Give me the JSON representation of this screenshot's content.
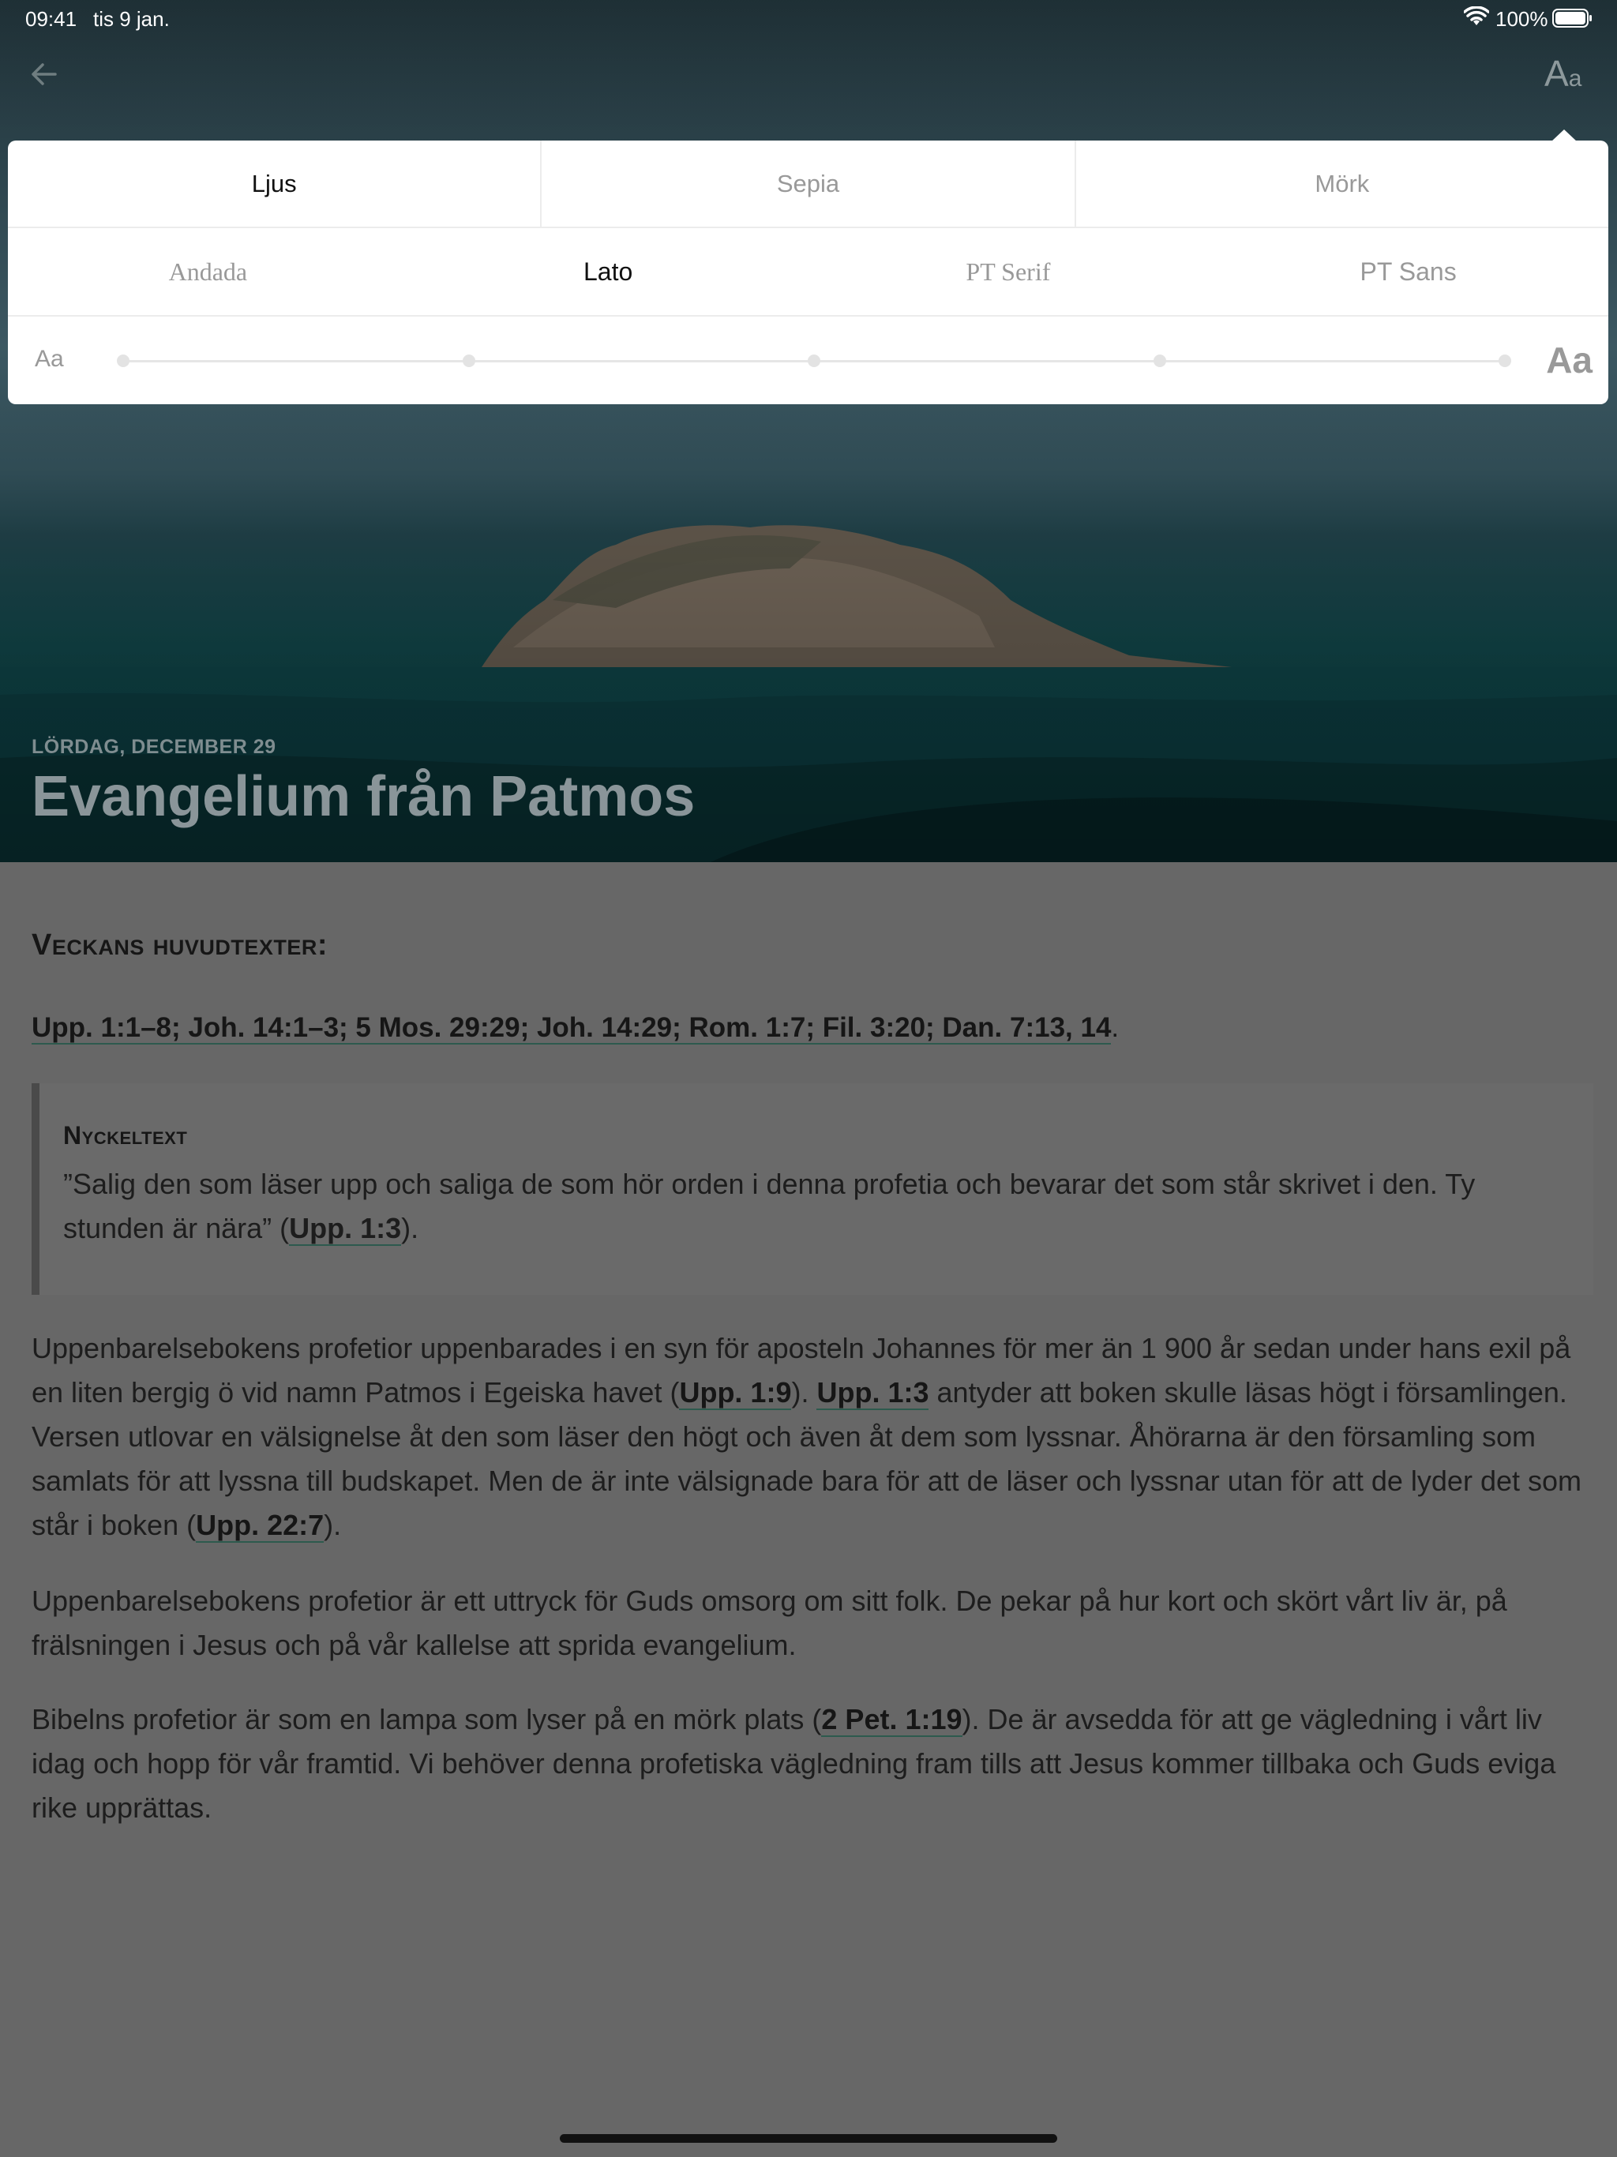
{
  "status_bar": {
    "time": "09:41",
    "date": "tis 9 jan.",
    "battery": "100%"
  },
  "nav": {
    "font_button_big": "A",
    "font_button_small": "a"
  },
  "settings_popover": {
    "themes": [
      "Ljus",
      "Sepia",
      "Mörk"
    ],
    "active_theme": "Ljus",
    "fonts": [
      "Andada",
      "Lato",
      "PT Serif",
      "PT Sans"
    ],
    "active_font": "Lato",
    "size_small_label": "Aa",
    "size_large_label": "Aa",
    "size_steps": 5,
    "size_level": 0
  },
  "hero": {
    "date": "LÖRDAG, DECEMBER 29",
    "title": "Evangelium från Patmos"
  },
  "article": {
    "weekly_heading": "Veckans huvudtexter:",
    "weekly_refs": "Upp. 1:1–8; Joh. 14:1–3; 5 Mos. 29:29; Joh. 14:29; Rom. 1:7; Fil. 3:20; Dan. 7:13, 14",
    "weekly_refs_end": ".",
    "key_heading": "Nyckeltext",
    "key_text": "”Salig den som läser upp och saliga de som hör orden i denna profetia och bevarar det som står skrivet i den. Ty stunden är nära” (",
    "key_ref": "Upp. 1:3",
    "key_end": ").",
    "p1_a": "Uppenbarelsebokens profetior uppenbarades i en syn för aposteln Johannes för mer än 1 900 år sedan under hans exil på en liten bergig ö vid namn Patmos i Egeiska havet (",
    "p1_ref1": "Upp. 1:9",
    "p1_b": "). ",
    "p1_ref2": "Upp. 1:3",
    "p1_c": " antyder att boken skulle läsas högt i församlingen. Versen utlovar en välsignelse åt den som läser den högt och även åt dem som lyssnar. Åhörarna är den församling som samlats för att lyssna till budskapet. Men de är inte välsignade bara för att de läser och lyssnar utan för att de lyder det som står i boken (",
    "p1_ref3": "Upp. 22:7",
    "p1_d": ").",
    "p2": "Uppenbarelsebokens profetior är ett uttryck för Guds omsorg om sitt folk. De pekar på hur kort och skört vårt liv är, på frälsningen i Jesus och på vår kallelse att sprida evangelium.",
    "p3_a": "Bibelns profetior är som en lampa som lyser på en mörk plats (",
    "p3_ref": "2 Pet. 1:19",
    "p3_b": "). De är avsedda för att ge vägledning i vårt liv idag och hopp för vår framtid. Vi behöver denna profetiska vägledning fram tills att Jesus kommer tillbaka och Guds eviga rike upprättas."
  },
  "colors": {
    "overlay": "#676767",
    "link_underline": "#2d5a4e",
    "popover_bg": "#ffffff"
  }
}
